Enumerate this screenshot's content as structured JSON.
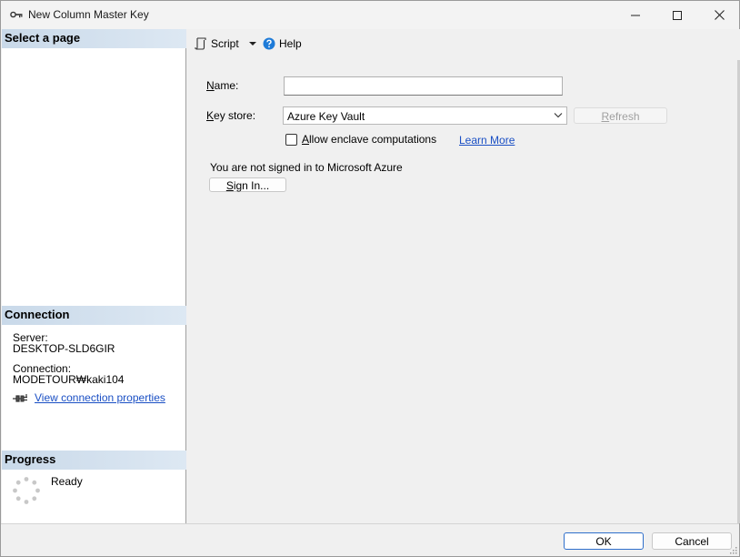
{
  "window": {
    "title": "New Column Master Key",
    "icon": "key-icon",
    "controls": [
      "minimize-icon",
      "maximize-icon",
      "close-icon"
    ]
  },
  "left_pane": {
    "select_page_header": "Select a page",
    "connection": {
      "header": "Connection",
      "server_label": "Server:",
      "server_value": "DESKTOP-SLD6GIR",
      "connection_label": "Connection:",
      "connection_value": "MODETOUR₩kaki104",
      "view_properties_link": "View connection properties"
    },
    "progress": {
      "header": "Progress",
      "status": "Ready"
    }
  },
  "toolbar": {
    "script_label": "Script",
    "help_label": "Help"
  },
  "form": {
    "name_label": "Name:",
    "name_value": "",
    "key_store_label": "Key store:",
    "key_store_value": "Azure Key Vault",
    "refresh_label": "Refresh",
    "allow_enclave_label": "Allow enclave computations",
    "allow_enclave_checked": false,
    "learn_more_link": "Learn More",
    "azure_status": "You are not signed in to Microsoft Azure",
    "sign_in_label": "Sign In..."
  },
  "footer": {
    "ok_label": "OK",
    "cancel_label": "Cancel"
  }
}
